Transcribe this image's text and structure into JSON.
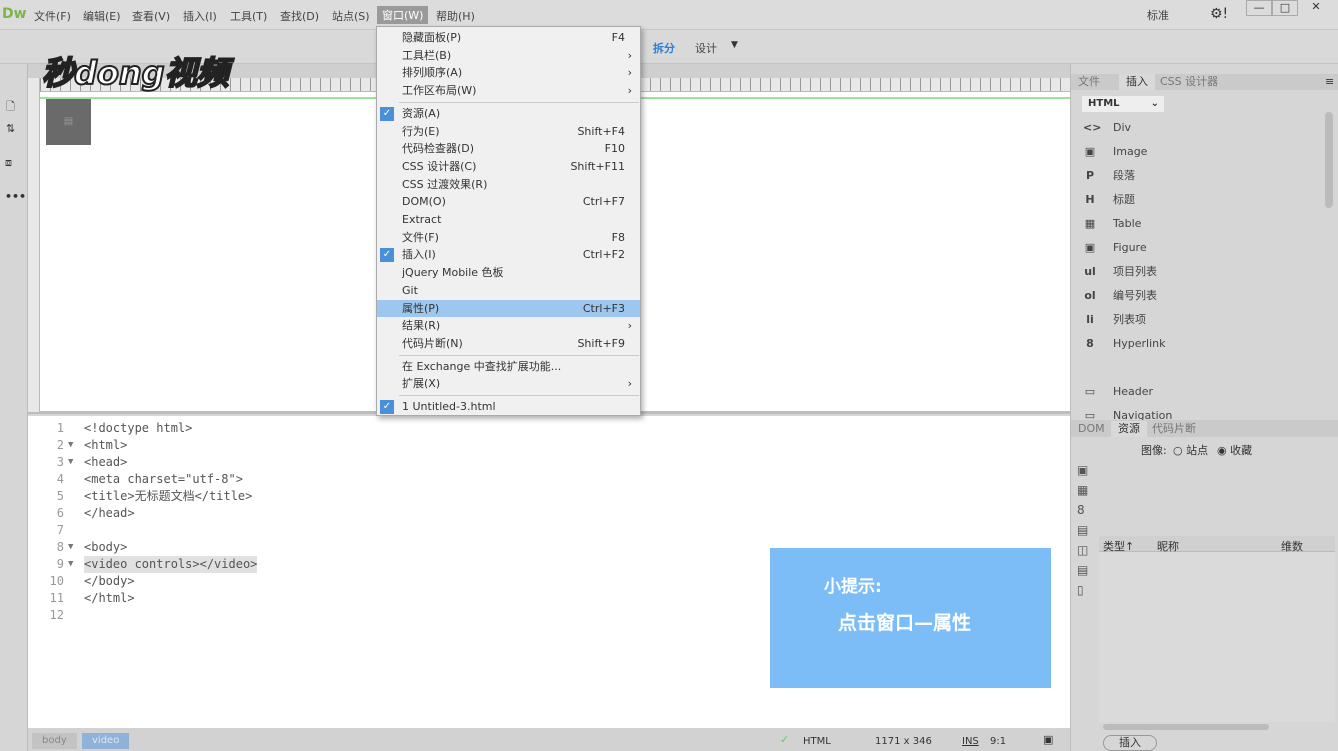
{
  "app": {
    "logo": "Dw",
    "watermark": "秒dong视频"
  },
  "menubar": [
    "文件(F)",
    "编辑(E)",
    "查看(V)",
    "插入(I)",
    "工具(T)",
    "查找(D)",
    "站点(S)",
    "窗口(W)",
    "帮助(H)"
  ],
  "topright": {
    "workspace": "标准",
    "minimize": "—",
    "maximize": "□",
    "close": "✕"
  },
  "toolbar": {
    "split": "拆分",
    "design": "设计"
  },
  "window_menu": [
    {
      "label": "隐藏面板(P)",
      "shortcut": "F4"
    },
    {
      "label": "工具栏(B)",
      "submenu": true
    },
    {
      "label": "排列顺序(A)",
      "submenu": true
    },
    {
      "label": "工作区布局(W)",
      "submenu": true
    },
    {
      "label": "资源(A)",
      "checked": true
    },
    {
      "label": "行为(E)",
      "shortcut": "Shift+F4"
    },
    {
      "label": "代码检查器(D)",
      "shortcut": "F10"
    },
    {
      "label": "CSS 设计器(C)",
      "shortcut": "Shift+F11"
    },
    {
      "label": "CSS 过渡效果(R)"
    },
    {
      "label": "DOM(O)",
      "shortcut": "Ctrl+F7"
    },
    {
      "label": "Extract"
    },
    {
      "label": "文件(F)",
      "shortcut": "F8"
    },
    {
      "label": "插入(I)",
      "shortcut": "Ctrl+F2",
      "checked": true
    },
    {
      "label": "jQuery Mobile 色板"
    },
    {
      "label": "Git"
    },
    {
      "label": "属性(P)",
      "shortcut": "Ctrl+F3",
      "highlighted": true
    },
    {
      "label": "结果(R)",
      "submenu": true
    },
    {
      "label": "代码片断(N)",
      "shortcut": "Shift+F9"
    },
    {
      "label": "在 Exchange 中查找扩展功能..."
    },
    {
      "label": "扩展(X)",
      "submenu": true
    },
    {
      "label": "1 Untitled-3.html",
      "checked": true
    }
  ],
  "code": [
    {
      "n": "1",
      "t": "<!doctype html>"
    },
    {
      "n": "2",
      "t": "<html>",
      "fold": true
    },
    {
      "n": "3",
      "t": "<head>",
      "fold": true
    },
    {
      "n": "4",
      "t": "<meta charset=\"utf-8\">"
    },
    {
      "n": "5",
      "t": "<title>无标题文档</title>"
    },
    {
      "n": "6",
      "t": "</head>"
    },
    {
      "n": "7",
      "t": ""
    },
    {
      "n": "8",
      "t": "<body>",
      "fold": true
    },
    {
      "n": "9",
      "t": "<video controls></video>",
      "fold": true,
      "selected": true
    },
    {
      "n": "10",
      "t": "</body>"
    },
    {
      "n": "11",
      "t": "</html>"
    },
    {
      "n": "12",
      "t": ""
    }
  ],
  "hint": {
    "title": "小提示:",
    "body": "点击窗口—属性"
  },
  "status": {
    "crumbs": [
      "body",
      "video"
    ],
    "doctype": "HTML",
    "size": "1171 x 346",
    "mode": "INS",
    "pos": "9:1"
  },
  "right_panel": {
    "tabs": [
      "文件",
      "插入",
      "CSS 设计器"
    ],
    "category": "HTML",
    "items": [
      {
        "icon": "<>",
        "label": "Div"
      },
      {
        "icon": "▣",
        "label": "Image"
      },
      {
        "icon": "P",
        "label": "段落"
      },
      {
        "icon": "H",
        "label": "标题"
      },
      {
        "icon": "▦",
        "label": "Table"
      },
      {
        "icon": "▣",
        "label": "Figure"
      },
      {
        "icon": "ul",
        "label": "项目列表"
      },
      {
        "icon": "ol",
        "label": "编号列表"
      },
      {
        "icon": "li",
        "label": "列表项"
      },
      {
        "icon": "8",
        "label": "Hyperlink"
      },
      {
        "icon": "▭",
        "label": "Header"
      },
      {
        "icon": "▭",
        "label": "Navigation"
      }
    ],
    "lower_tabs": [
      "DOM",
      "资源",
      "代码片断"
    ],
    "image_label": "图像:",
    "radio_site": "站点",
    "radio_fav": "收藏",
    "columns": [
      "类型",
      "昵称",
      "维数"
    ],
    "insert_button": "插入"
  },
  "colors": {
    "hint_bg": "#7dbdf7",
    "menu_highlight": "#9ec7ef"
  }
}
